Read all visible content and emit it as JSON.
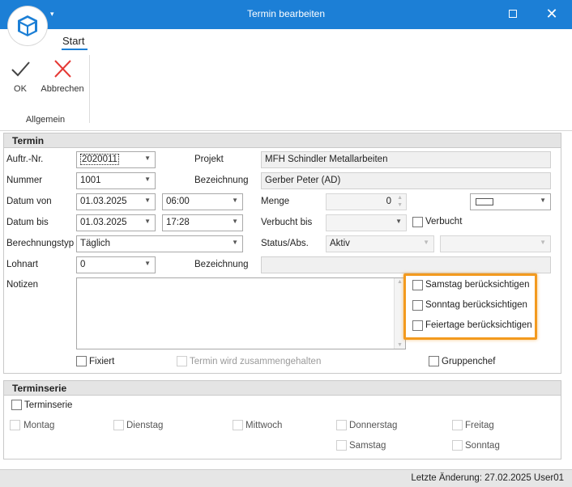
{
  "window": {
    "title": "Termin bearbeiten",
    "close_glyph": "✕",
    "logo_arrow": "▾"
  },
  "ribbon": {
    "tab": "Start",
    "ok_label": "OK",
    "cancel_label": "Abbrechen",
    "group_label": "Allgemein"
  },
  "termin": {
    "header": "Termin",
    "auftr_label": "Auftr.-Nr.",
    "auftr_value": "2020011",
    "projekt_label": "Projekt",
    "projekt_value": "MFH Schindler Metallarbeiten",
    "nummer_label": "Nummer",
    "nummer_value": "1001",
    "bezeichnung_label": "Bezeichnung",
    "bezeichnung_value": "Gerber Peter (AD)",
    "datum_von_label": "Datum von",
    "datum_von_value": "01.03.2025",
    "zeit_von_value": "06:00",
    "menge_label": "Menge",
    "menge_value": "0",
    "datum_bis_label": "Datum bis",
    "datum_bis_value": "01.03.2025",
    "zeit_bis_value": "17:28",
    "verbucht_bis_label": "Verbucht bis",
    "verbucht_label": "Verbucht",
    "berechnungstyp_label": "Berechnungstyp",
    "berechnungstyp_value": "Täglich",
    "status_label": "Status/Abs.",
    "status_value": "Aktiv",
    "lohnart_label": "Lohnart",
    "lohnart_value": "0",
    "bezeichnung2_label": "Bezeichnung",
    "notizen_label": "Notizen",
    "samstag_label": "Samstag berücksichtigen",
    "sonntag_label": "Sonntag berücksichtigen",
    "feiertage_label": "Feiertage berücksichtigen",
    "fixiert_label": "Fixiert",
    "zusammen_label": "Termin wird zusammengehalten",
    "gruppenchef_label": "Gruppenchef"
  },
  "terminserie": {
    "header": "Terminserie",
    "checkbox_label": "Terminserie",
    "days": [
      "Montag",
      "Dienstag",
      "Mittwoch",
      "Donnerstag",
      "Freitag",
      "Samstag",
      "Sonntag"
    ]
  },
  "status": {
    "text": "Letzte Änderung: 27.02.2025 User01"
  },
  "colors": {
    "accent": "#1c7fd6",
    "highlight": "#f39a1e",
    "cancel_red": "#e53935"
  },
  "icons": {
    "ok": "checkmark-icon",
    "cancel": "x-icon",
    "logo": "cube-icon"
  }
}
